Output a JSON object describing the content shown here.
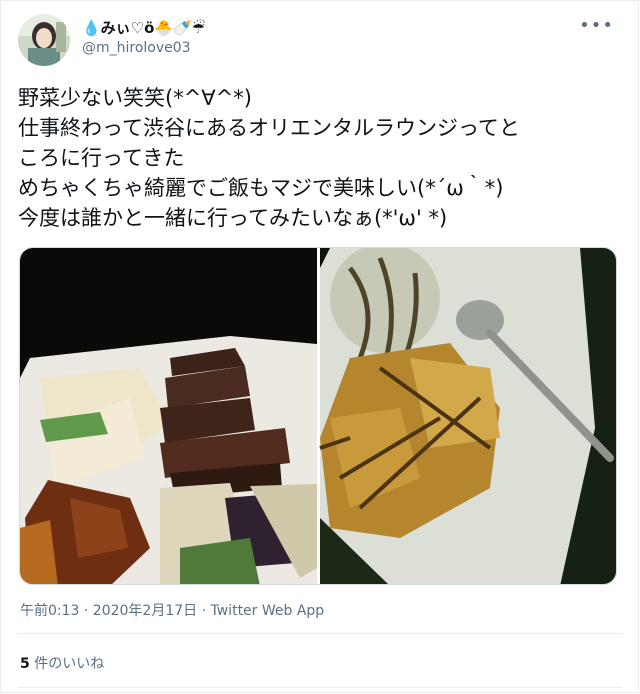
{
  "tweet": {
    "display_name": "💧みぃ♡ö🐣🍼☔",
    "handle": "@m_hirolove03",
    "more_icon": "more-dots-icon",
    "text_lines": [
      "野菜少ない笑笑(*^∀^*)",
      "仕事終わって渋谷にあるオリエンタルラウンジってと",
      "ころに行ってきた",
      "めちゃくちゃ綺麗でご飯もマジで美味しい(*´ω｀*)",
      "今度は誰かと一緒に行ってみたいなぁ(*'ω' *)"
    ],
    "timestamp": "午前0:13 · 2020年2月17日 · ",
    "source": "Twitter Web App",
    "likes_count": "5",
    "likes_label": " 件のいいね"
  }
}
